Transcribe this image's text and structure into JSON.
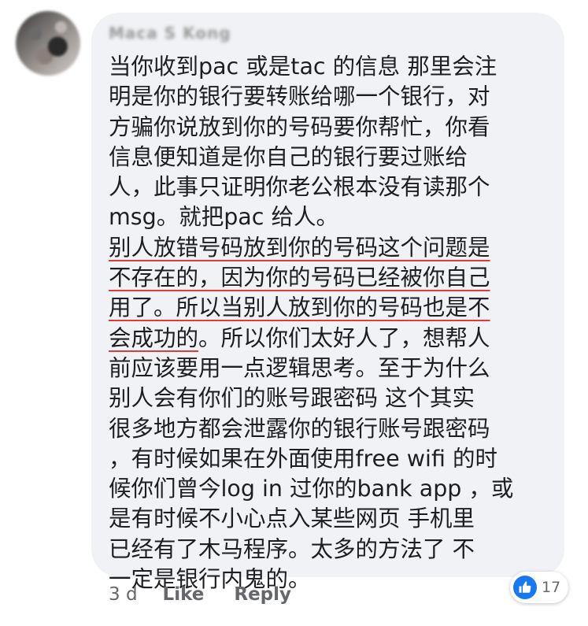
{
  "comment": {
    "author": "Maca S Kong",
    "lines": [
      {
        "text": "当你收到pac 或是tac 的信息 那里会注",
        "highlight": false
      },
      {
        "text": "明是你的银行要转账给哪一个银行，对",
        "highlight": false
      },
      {
        "text": "方骗你说放到你的号码要你帮忙，你看",
        "highlight": false
      },
      {
        "text": "信息便知道是你自己的银行要过账给",
        "highlight": false
      },
      {
        "text": "人，此事只证明你老公根本没有读那个",
        "highlight": false
      },
      {
        "text": "msg。就把pac 给人。",
        "highlight": false
      },
      {
        "text": "别人放错号码放到你的号码这个问题是",
        "highlight": true
      },
      {
        "text": "不存在的，因为你的号码已经被你自己",
        "highlight": true
      },
      {
        "text": "用了。所以当别人放到你的号码也是不",
        "highlight": true
      },
      {
        "pre": "",
        "hl": "会成功的",
        "post": "。所以你们太好人了，想帮人",
        "mixed": true
      },
      {
        "text": "前应该要用一点逻辑思考。至于为什么",
        "highlight": false
      },
      {
        "text": "别人会有你们的账号跟密码 这个其实",
        "highlight": false
      },
      {
        "text": "很多地方都会泄露你的银行账号跟密码",
        "highlight": false
      },
      {
        "text": "，有时候如果在外面使用free wifi 的时",
        "highlight": false
      },
      {
        "text": "候你们曾今log in 过你的bank app ，或",
        "highlight": false
      },
      {
        "text": "是有时候不小心点入某些网页 手机里",
        "highlight": false
      },
      {
        "text": "已经有了木马程序。太多的方法了 不",
        "highlight": false
      },
      {
        "text": "一定是银行内鬼的。",
        "highlight": false
      }
    ],
    "time": "3 d",
    "like_label": "Like",
    "reply_label": "Reply",
    "reaction_count": "17"
  },
  "colors": {
    "bubble": "#f0f2f5",
    "text": "#1c1e21",
    "meta": "#65676b",
    "like_blue": "#1877f2",
    "underline": "#e03a3a"
  },
  "icons": {
    "reaction": "thumbs-up-icon"
  }
}
